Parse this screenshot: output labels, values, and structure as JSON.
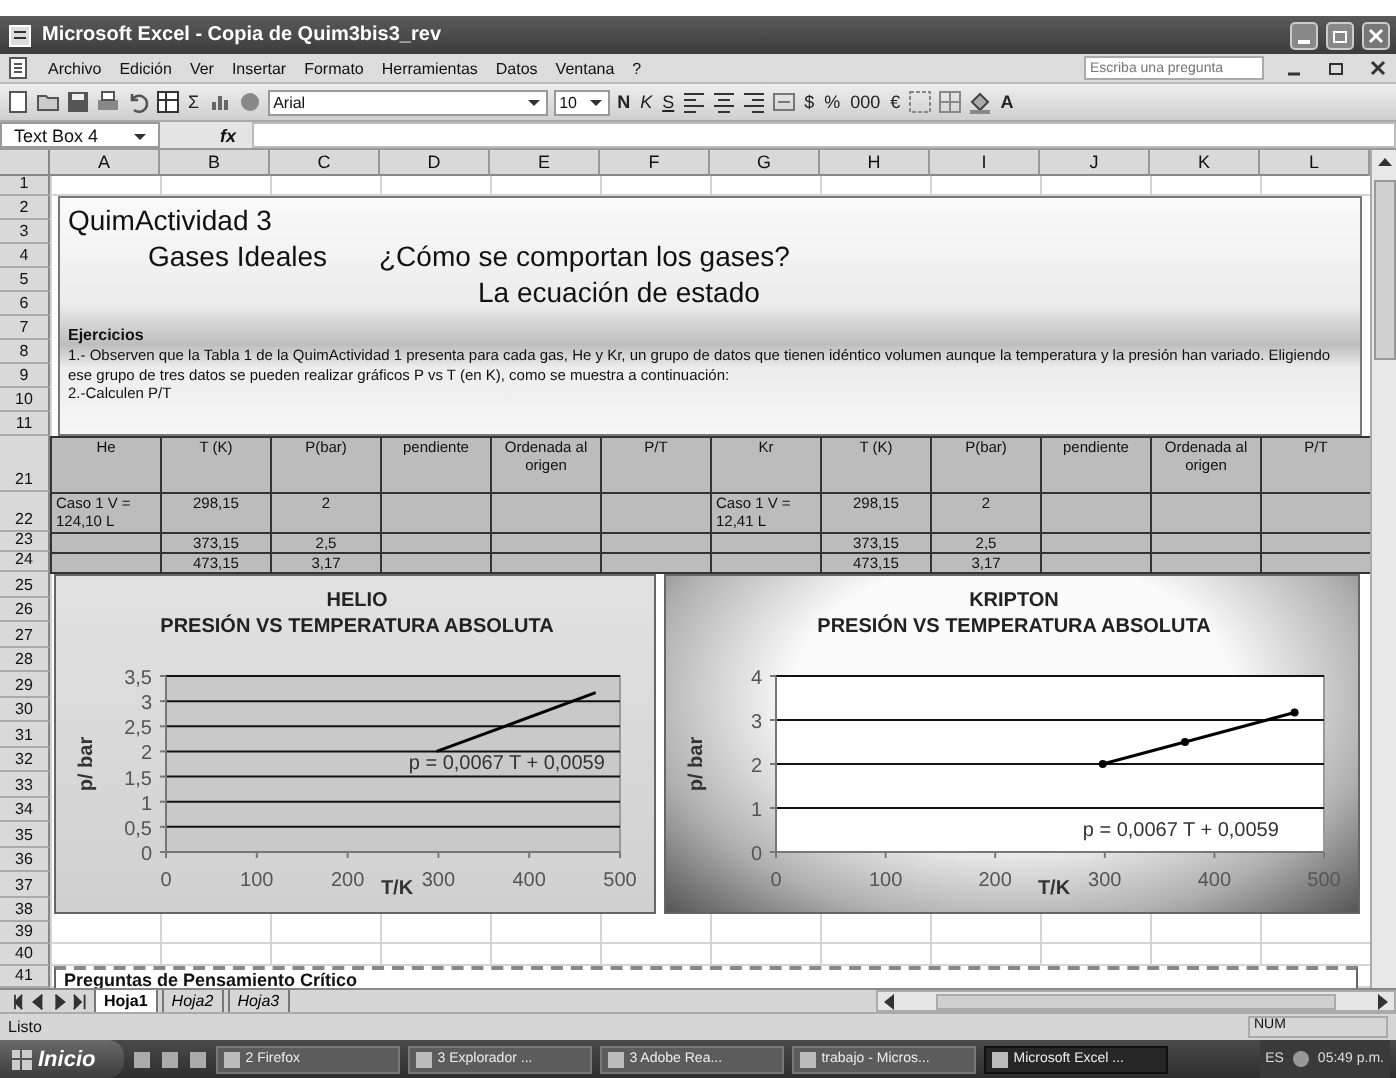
{
  "window": {
    "title": "Microsoft Excel - Copia de Quim3bis3_rev"
  },
  "menu": [
    "Archivo",
    "Edición",
    "Ver",
    "Insertar",
    "Formato",
    "Herramientas",
    "Datos",
    "Ventana",
    "?"
  ],
  "help_box": {
    "placeholder": "Escriba una pregunta"
  },
  "toolbar": {
    "sum": "Σ",
    "font": "Arial",
    "size": "10",
    "format_buttons": [
      "N",
      "K",
      "S"
    ],
    "number_buttons": [
      "$",
      "%",
      "000",
      "€"
    ],
    "font_color": "A"
  },
  "formula_bar": {
    "name_box": "Text Box 4",
    "fx": "fx"
  },
  "columns": [
    "A",
    "B",
    "C",
    "D",
    "E",
    "F",
    "G",
    "H",
    "I",
    "J",
    "K",
    "L"
  ],
  "top_rows": [
    "1",
    "2",
    "3",
    "4",
    "5",
    "6",
    "7",
    "8",
    "9",
    "10",
    "11"
  ],
  "text_box": {
    "title": "QuimActividad 3",
    "topic": "Gases Ideales",
    "question": "¿Cómo se comportan los gases?",
    "subtitle": "La ecuación de estado",
    "section": "Ejercicios",
    "paragraphs": [
      "1.- Observen que la Tabla 1 de la QuimActividad 1 presenta  para cada gas, He y Kr, un grupo de datos que tienen idéntico volumen aunque la temperatura y la presión han variado. Eligiendo ese grupo de tres datos se pueden realizar gráficos P vs T (en K), como se muestra a continuación:",
      "2.-Calculen P/T"
    ]
  },
  "table": {
    "row_numbers": [
      "21",
      "22",
      "23",
      "24"
    ],
    "rows": [
      [
        "He",
        "T (K)",
        "P(bar)",
        "pendiente",
        "Ordenada al origen",
        "P/T",
        "Kr",
        "T (K)",
        "P(bar)",
        "pendiente",
        "Ordenada al origen",
        "P/T"
      ],
      [
        "Caso 1 V = 124,10 L",
        "298,15",
        "2",
        null,
        null,
        null,
        "Caso 1 V = 12,41 L",
        "298,15",
        "2",
        null,
        null,
        null
      ],
      [
        null,
        "373,15",
        "2,5",
        null,
        null,
        null,
        null,
        "373,15",
        "2,5",
        null,
        null,
        null
      ],
      [
        null,
        "473,15",
        "3,17",
        null,
        null,
        null,
        null,
        "473,15",
        "3,17",
        null,
        null,
        null
      ]
    ]
  },
  "chart_rows": [
    "25",
    "26",
    "27",
    "28",
    "29",
    "30",
    "31",
    "32",
    "33",
    "34",
    "35",
    "36",
    "37",
    "38"
  ],
  "charts": [
    {
      "kind": "plain",
      "chart_data": {
        "type": "line",
        "grid": true,
        "title": "HELIO\nPRESIÓN VS TEMPERATURA  ABSOLUTA",
        "xlabel": "T/K",
        "ylabel": "p/ bar",
        "x": [
          298.15,
          373.15,
          473.15
        ],
        "series": [
          {
            "color": "#000000",
            "marker": false,
            "values": [
              2,
              2.5,
              3.17
            ]
          }
        ],
        "xlim": [
          0,
          500
        ],
        "ylim": [
          0,
          3.5
        ],
        "xticks": [
          0,
          100,
          200,
          300,
          400,
          500
        ],
        "yticks": [
          {
            "value": 0,
            "label": "0"
          },
          {
            "value": 0.5,
            "label": "0,5"
          },
          {
            "value": 1,
            "label": "1"
          },
          {
            "value": 1.5,
            "label": "1,5"
          },
          {
            "value": 2,
            "label": "2"
          },
          {
            "value": 2.5,
            "label": "2,5"
          },
          {
            "value": 3,
            "label": "3"
          },
          {
            "value": 3.5,
            "label": "3,5"
          }
        ],
        "annotations": [
          "p = 0,0067 T + 0,0059"
        ]
      }
    },
    {
      "kind": "shaded",
      "chart_data": {
        "type": "line",
        "grid": true,
        "title": "KRIPTON\nPRESIÓN VS TEMPERATURA ABSOLUTA",
        "xlabel": "T/K",
        "ylabel": "p/ bar",
        "x": [
          298.15,
          373.15,
          473.15
        ],
        "series": [
          {
            "color": "#000000",
            "marker": true,
            "values": [
              2,
              2.5,
              3.17
            ]
          }
        ],
        "xlim": [
          0,
          500
        ],
        "ylim": [
          0,
          4
        ],
        "xticks": [
          0,
          100,
          200,
          300,
          400,
          500
        ],
        "yticks": [
          0,
          1,
          2,
          3,
          4
        ],
        "annotations": [
          "p = 0,0067 T + 0,0059"
        ]
      }
    }
  ],
  "lower_rows": [
    "39",
    "40",
    "41"
  ],
  "bottom_text_box": {
    "text": "Preguntas de Pensamiento Crítico"
  },
  "sheet_tabs": [
    {
      "label": "Hoja1",
      "selected": true
    },
    {
      "label": "Hoja2",
      "selected": false
    },
    {
      "label": "Hoja3",
      "selected": false
    }
  ],
  "status_bar": {
    "text": "Listo",
    "indicator": "NUM"
  },
  "taskbar": {
    "start": "Inicio",
    "items": [
      {
        "label": "2 Firefox",
        "selected": false
      },
      {
        "label": "3 Explorador ...",
        "selected": false
      },
      {
        "label": "3 Adobe Rea...",
        "selected": false
      },
      {
        "label": "trabajo - Micros...",
        "selected": false
      },
      {
        "label": "Microsoft Excel ...",
        "selected": true
      }
    ],
    "language": "ES",
    "clock": "05:49 p.m."
  }
}
